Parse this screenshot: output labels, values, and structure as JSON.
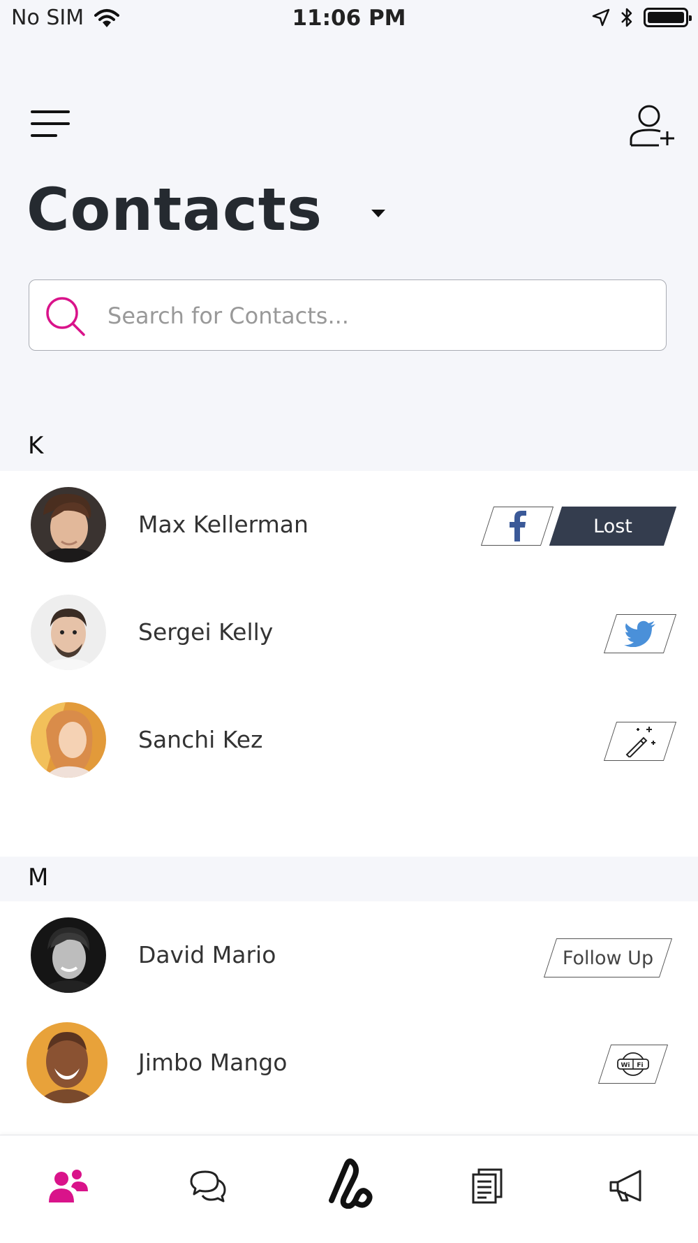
{
  "status_bar": {
    "carrier": "No SIM",
    "time": "11:06 PM"
  },
  "header": {
    "title": "Contacts"
  },
  "search": {
    "placeholder": "Search for Contacts..."
  },
  "colors": {
    "accent": "#d9138a",
    "tag_dark": "#343d4e",
    "twitter": "#4a90d9",
    "facebook": "#3b5998"
  },
  "sections": [
    {
      "letter": "K",
      "contacts": [
        {
          "name": "Max Kellerman",
          "tags": [
            {
              "type": "icon",
              "icon": "facebook-icon"
            },
            {
              "type": "text",
              "label": "Lost",
              "style": "dark"
            }
          ]
        },
        {
          "name": "Sergei Kelly",
          "tags": [
            {
              "type": "icon",
              "icon": "twitter-icon"
            }
          ]
        },
        {
          "name": "Sanchi Kez",
          "tags": [
            {
              "type": "icon",
              "icon": "magic-wand-icon"
            }
          ]
        }
      ]
    },
    {
      "letter": "M",
      "contacts": [
        {
          "name": "David Mario",
          "tags": [
            {
              "type": "text",
              "label": "Follow Up",
              "style": "light"
            }
          ]
        },
        {
          "name": "Jimbo Mango",
          "tags": [
            {
              "type": "icon",
              "icon": "wifi-icon"
            }
          ]
        }
      ]
    }
  ],
  "tabbar": {
    "tabs": [
      {
        "icon": "contacts-icon",
        "active": true
      },
      {
        "icon": "chat-icon",
        "active": false
      },
      {
        "icon": "app-logo-icon",
        "active": false
      },
      {
        "icon": "document-icon",
        "active": false
      },
      {
        "icon": "megaphone-icon",
        "active": false
      }
    ]
  }
}
